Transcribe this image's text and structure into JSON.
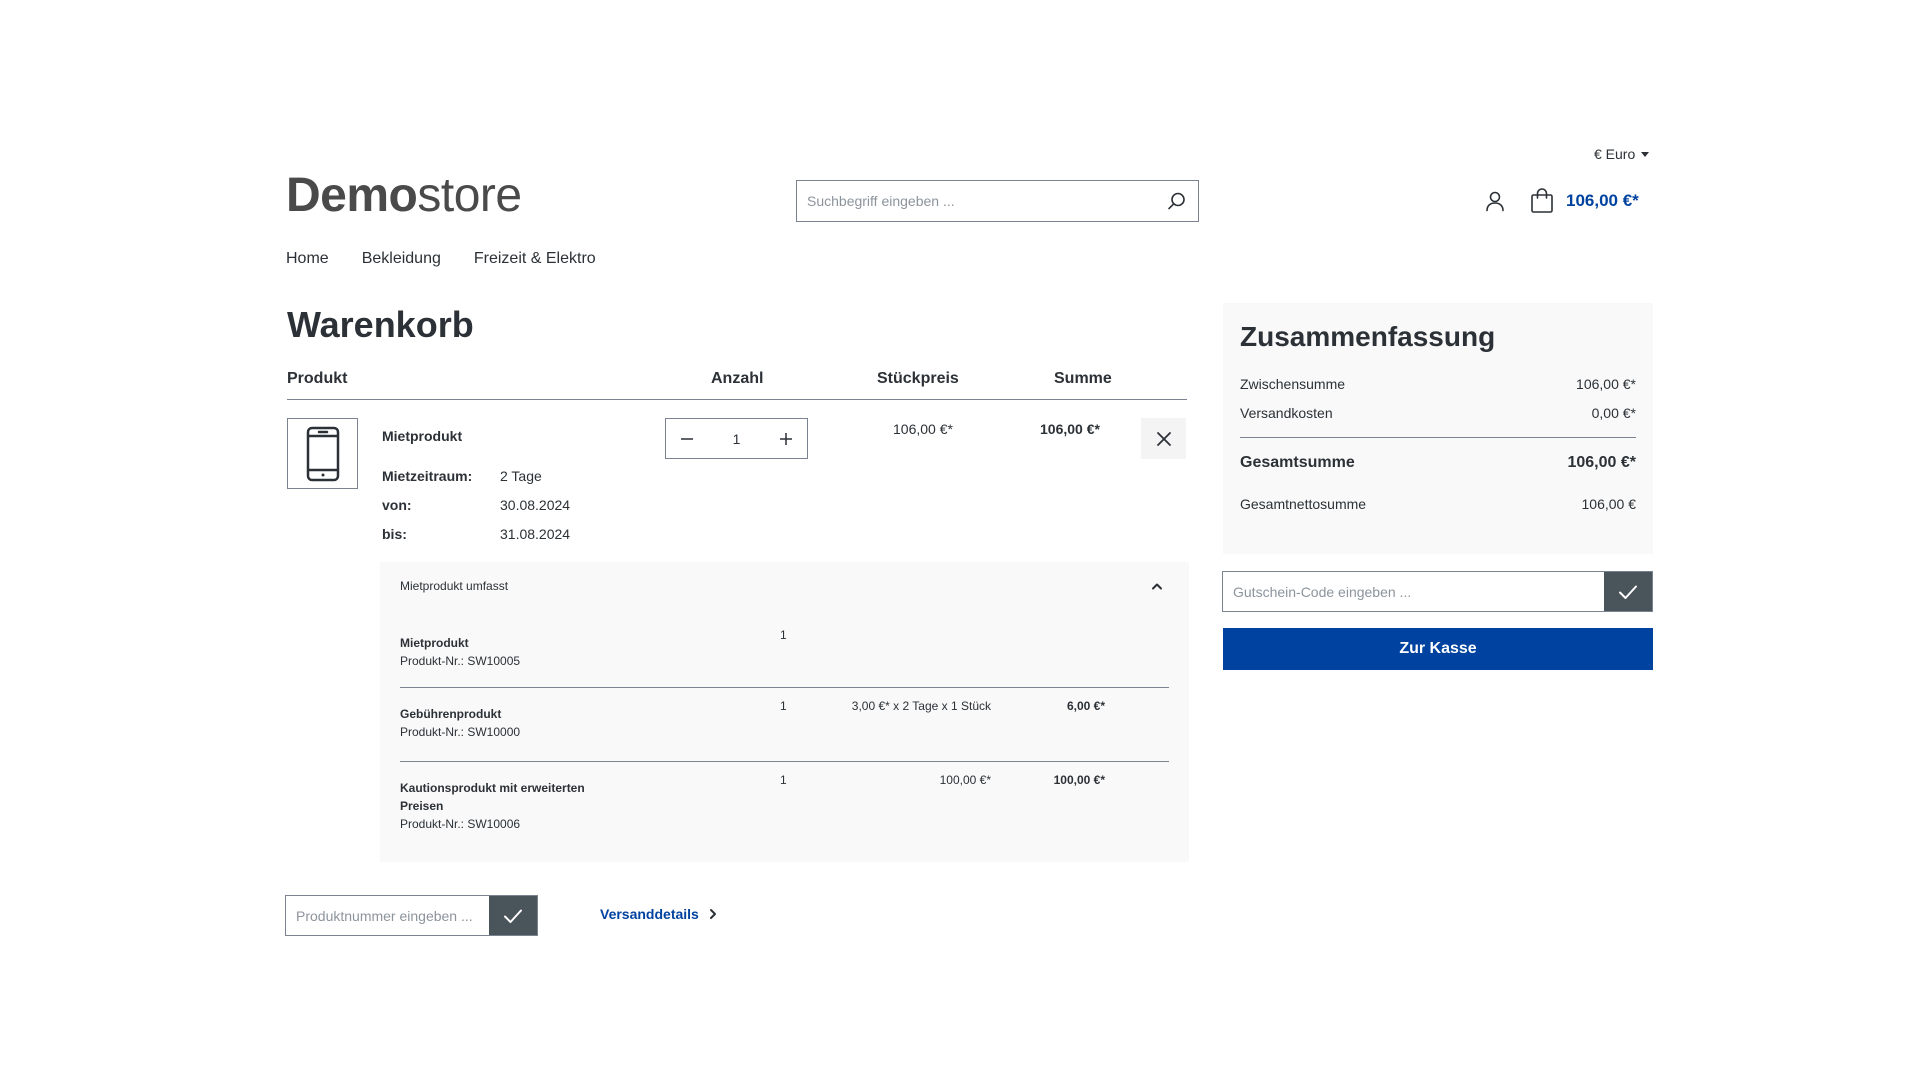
{
  "header": {
    "currency_label": "€ Euro",
    "logo_bold": "Demo",
    "logo_light": "store",
    "search_placeholder": "Suchbegriff eingeben ...",
    "cart_total": "106,00 €*"
  },
  "nav": {
    "items": [
      {
        "label": "Home"
      },
      {
        "label": "Bekleidung"
      },
      {
        "label": "Freizeit & Elektro"
      }
    ]
  },
  "cart": {
    "title": "Warenkorb",
    "columns": {
      "product": "Produkt",
      "quantity": "Anzahl",
      "unit_price": "Stückpreis",
      "total": "Summe"
    },
    "item": {
      "name": "Mietprodukt",
      "rental_period_label": "Mietzeitraum:",
      "rental_period_value": "2 Tage",
      "from_label": "von:",
      "from_value": "30.08.2024",
      "to_label": "bis:",
      "to_value": "31.08.2024",
      "quantity": "1",
      "unit_price": "106,00 €*",
      "total": "106,00 €*"
    },
    "bundle": {
      "heading": "Mietprodukt umfasst",
      "rows": [
        {
          "name": "Mietprodukt",
          "sku": "Produkt-Nr.: SW10005",
          "qty": "1",
          "price": "",
          "total": ""
        },
        {
          "name": "Gebührenprodukt",
          "sku": "Produkt-Nr.: SW10000",
          "qty": "1",
          "price": "3,00 €* x 2 Tage x 1 Stück",
          "total": "6,00 €*"
        },
        {
          "name": "Kautionsprodukt mit erweiterten Preisen",
          "sku": "Produkt-Nr.: SW10006",
          "qty": "1",
          "price": "100,00 €*",
          "total": "100,00 €*"
        }
      ]
    },
    "product_number_placeholder": "Produktnummer eingeben ...",
    "shipping_link": "Versanddetails"
  },
  "summary": {
    "title": "Zusammenfassung",
    "subtotal_label": "Zwischensumme",
    "subtotal_value": "106,00 €*",
    "shipping_label": "Versandkosten",
    "shipping_value": "0,00 €*",
    "grand_total_label": "Gesamtsumme",
    "grand_total_value": "106,00 €*",
    "net_total_label": "Gesamtnettosumme",
    "net_total_value": "106,00 €",
    "voucher_placeholder": "Gutschein-Code eingeben ...",
    "checkout_label": "Zur Kasse"
  },
  "colors": {
    "brand_blue": "#0042a0",
    "dark_button": "#4a545b",
    "text": "#2b3136",
    "panel_bg": "#f9f9f9",
    "border": "#798490"
  },
  "icons": {
    "search": "search-icon",
    "account": "user-icon",
    "cart": "shopping-bag-icon",
    "remove": "close-icon",
    "minus": "minus-icon",
    "plus": "plus-icon",
    "check": "check-icon",
    "chevron_up": "chevron-up-icon",
    "chevron_right": "chevron-right-icon",
    "product": "smartphone-icon"
  }
}
